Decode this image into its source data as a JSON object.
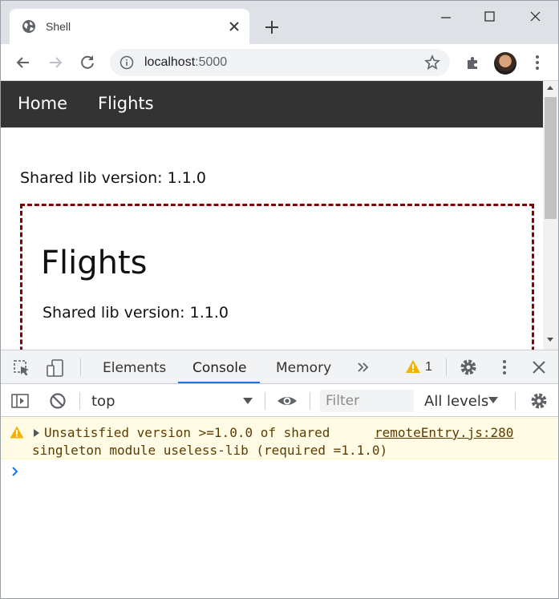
{
  "browser": {
    "tab_title": "Shell",
    "url_host": "localhost",
    "url_port": ":5000"
  },
  "page": {
    "nav": {
      "home": "Home",
      "flights": "Flights"
    },
    "shell_version": "Shared lib version: 1.1.0",
    "remote": {
      "heading": "Flights",
      "version": "Shared lib version: 1.1.0"
    }
  },
  "devtools": {
    "tabs": {
      "elements": "Elements",
      "console": "Console",
      "memory": "Memory"
    },
    "warning_count": "1",
    "context": "top",
    "filter_placeholder": "Filter",
    "levels": "All levels",
    "message": {
      "line1": "Unsatisfied version >=1.0.0 of shared",
      "line2": "singleton module useless-lib (required =1.1.0)",
      "source": "remoteEntry.js:280"
    }
  },
  "colors": {
    "navbar": "#333333",
    "remote_border": "#8b0000",
    "warning_bg": "#fffbe5",
    "accent": "#1a73e8"
  }
}
